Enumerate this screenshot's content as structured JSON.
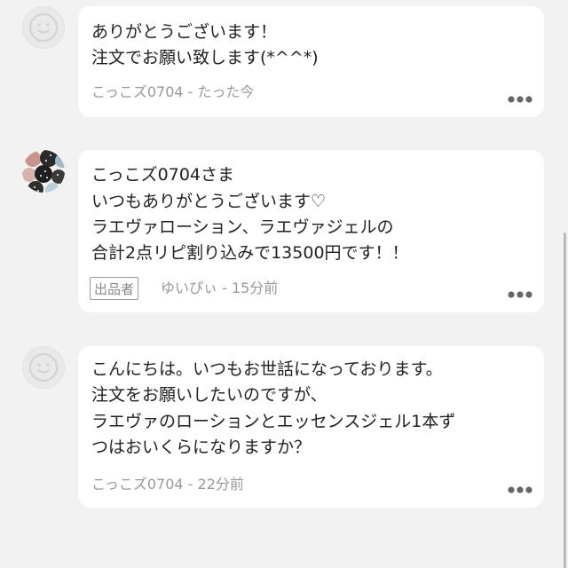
{
  "messages": [
    {
      "lines": [
        "ありがとうございます！",
        "注文でお願い致します(*^^*)"
      ],
      "meta": "こっこズ0704 - たった今",
      "more_icon": "more-horizontal-icon"
    },
    {
      "lines": [
        "こっこズ0704さま",
        "いつもありがとうございます♡",
        "ラエヴァローション、ラエヴァジェルの",
        "合計2点リピ割り込みで13500円です！！"
      ],
      "badge": "出品者",
      "meta": "ゆいぴぃ - 15分前",
      "more_icon": "more-horizontal-icon"
    },
    {
      "lines": [
        "こんにちは。いつもお世話になっております。",
        "注文をお願いしたいのですが、",
        "ラエヴァのローションとエッセンスジェル1本ず",
        "つはおいくらになりますか？"
      ],
      "meta": "こっこズ0704 - 22分前",
      "more_icon": "more-horizontal-icon"
    }
  ],
  "colors": {
    "background": "#f2f2f2",
    "bubble": "#ffffff",
    "text": "#222222",
    "meta": "#999999"
  }
}
